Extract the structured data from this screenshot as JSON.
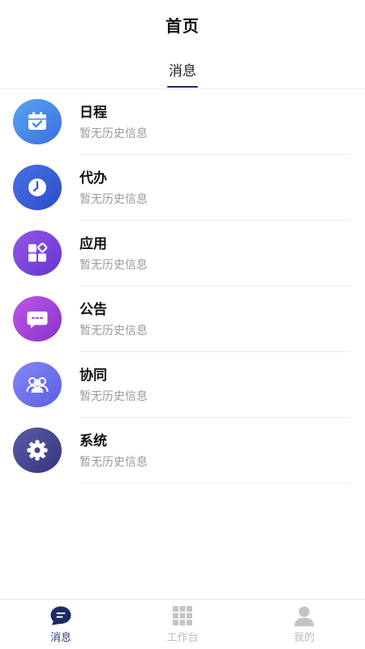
{
  "header": {
    "title": "首页"
  },
  "tabs": [
    {
      "label": "消息",
      "active": true
    }
  ],
  "messages": [
    {
      "title": "日程",
      "subtitle": "暂无历史信息",
      "icon": "calendar-check-icon",
      "color_from": "#4e97ef",
      "color_to": "#3a73e2"
    },
    {
      "title": "代办",
      "subtitle": "暂无历史信息",
      "icon": "clock-icon",
      "color_from": "#3f63dd",
      "color_to": "#2f4fcb"
    },
    {
      "title": "应用",
      "subtitle": "暂无历史信息",
      "icon": "apps-grid-icon",
      "color_from": "#8a4fe6",
      "color_to": "#6d39d6"
    },
    {
      "title": "公告",
      "subtitle": "暂无历史信息",
      "icon": "chat-bubble-icon",
      "color_from": "#b04fe0",
      "color_to": "#9137d2"
    },
    {
      "title": "协同",
      "subtitle": "暂无历史信息",
      "icon": "users-icon",
      "color_from": "#7c7ef2",
      "color_to": "#5d63e6"
    },
    {
      "title": "系统",
      "subtitle": "暂无历史信息",
      "icon": "gear-icon",
      "color_from": "#4e4e9e",
      "color_to": "#3a3a86"
    }
  ],
  "bottom_nav": [
    {
      "label": "消息",
      "icon": "message-icon",
      "active": true
    },
    {
      "label": "工作台",
      "icon": "grid-icon",
      "active": false
    },
    {
      "label": "我的",
      "icon": "user-icon",
      "active": false
    }
  ],
  "colors": {
    "accent": "#1d2a6b",
    "active_nav": "#2a3a7a",
    "inactive": "#bcbcbc",
    "subtitle": "#9a9a9a"
  }
}
